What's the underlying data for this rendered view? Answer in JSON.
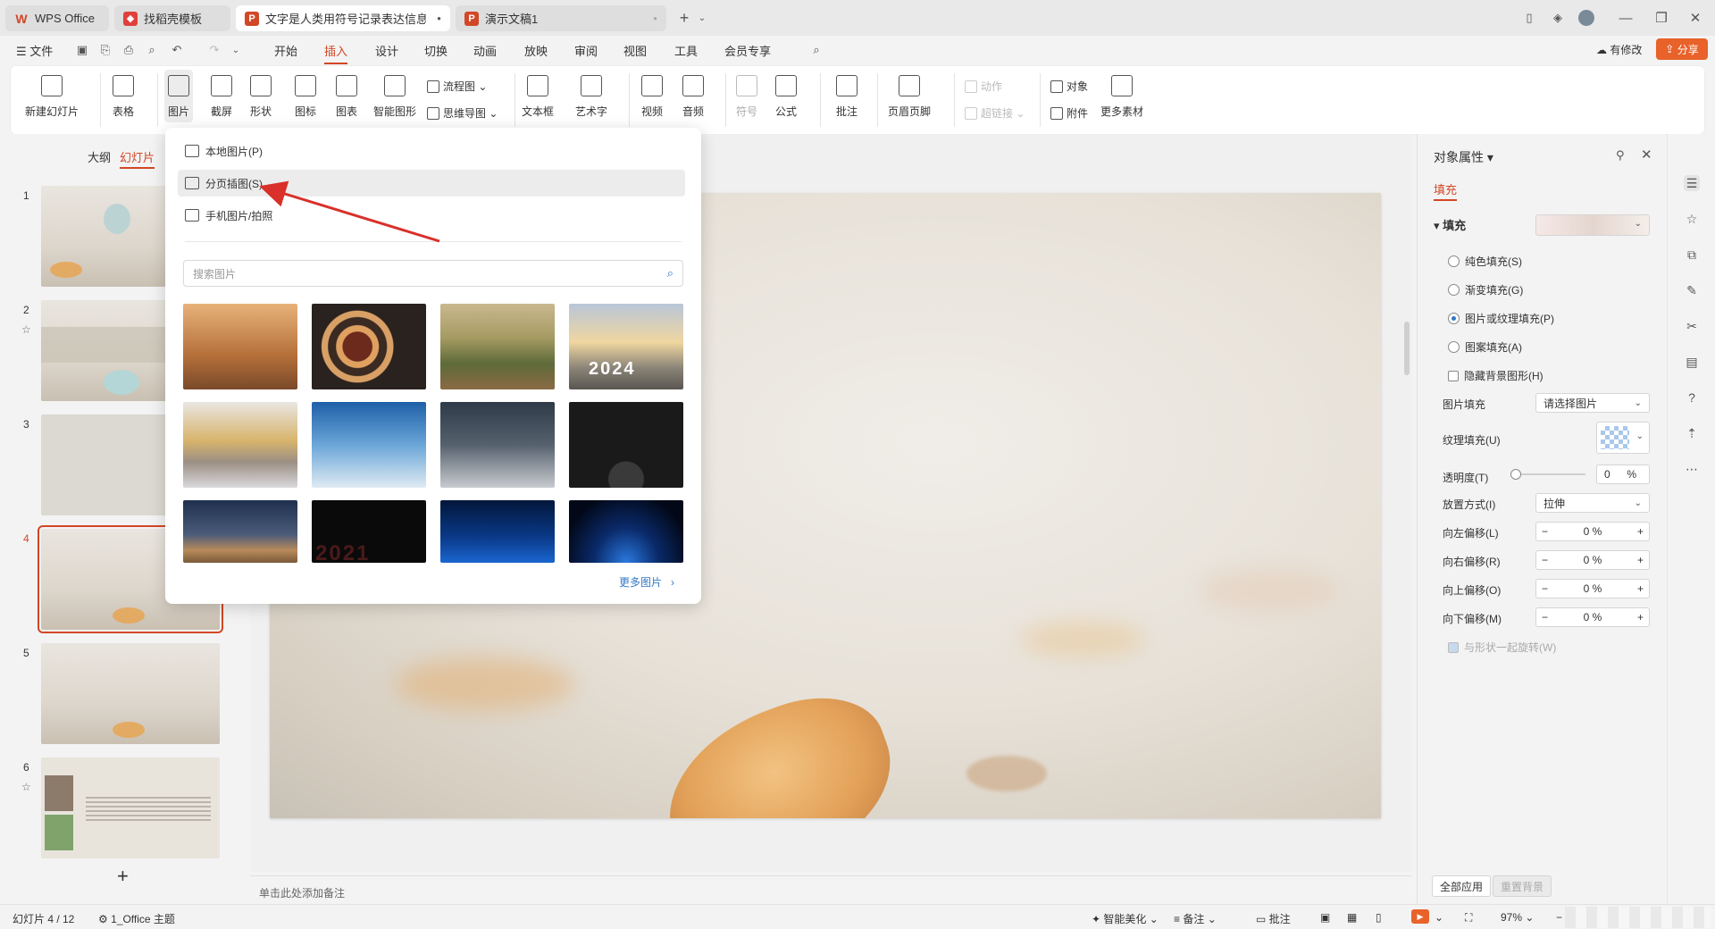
{
  "tabs": [
    {
      "label": "WPS Office",
      "icon": "wps-logo-icon",
      "color": "#d24726"
    },
    {
      "label": "找稻壳模板",
      "icon": "docer-icon",
      "color": "#e0403c"
    },
    {
      "label": "文字是人类用符号记录表达信息以",
      "icon": "ppt-icon",
      "color": "#d24726"
    },
    {
      "label": "演示文稿1",
      "icon": "ppt-icon",
      "color": "#d24726"
    }
  ],
  "menu": {
    "file": "文件",
    "items": [
      "开始",
      "插入",
      "设计",
      "切换",
      "动画",
      "放映",
      "审阅",
      "视图",
      "工具",
      "会员专享"
    ],
    "active": "插入",
    "modified": "有修改",
    "share": "分享"
  },
  "ribbon": {
    "new_slide": "新建幻灯片",
    "table": "表格",
    "picture": "图片",
    "screenshot": "截屏",
    "shape": "形状",
    "icon": "图标",
    "chart": "图表",
    "smart_graphic": "智能图形",
    "flowchart": "流程图",
    "mindmap": "思维导图",
    "textbox": "文本框",
    "wordart": "艺术字",
    "video": "视频",
    "audio": "音频",
    "symbol": "符号",
    "formula": "公式",
    "comment": "批注",
    "header_footer": "页眉页脚",
    "action": "动作",
    "hyperlink": "超链接",
    "object": "对象",
    "attachment": "附件",
    "more_material": "更多素材"
  },
  "left_panel": {
    "tab_outline": "大纲",
    "tab_slides": "幻灯片",
    "slides": [
      "1",
      "2",
      "3",
      "4",
      "5",
      "6"
    ],
    "selected": "4"
  },
  "dropdown": {
    "items": [
      "本地图片(P)",
      "分页插图(S)",
      "手机图片/拍照"
    ],
    "search_placeholder": "搜索图片",
    "more": "更多图片",
    "thumb_text_2024": "2024",
    "thumb_text_2021": "2021"
  },
  "notes_placeholder": "单击此处添加备注",
  "right_panel": {
    "title": "对象属性",
    "tab_fill": "填充",
    "section_fill": "填充",
    "options": [
      "纯色填充(S)",
      "渐变填充(G)",
      "图片或纹理填充(P)",
      "图案填充(A)"
    ],
    "selected_option": "图片或纹理填充(P)",
    "hide_bg": "隐藏背景图形(H)",
    "picture_fill_label": "图片填充",
    "picture_fill_value": "请选择图片",
    "texture_fill_label": "纹理填充(U)",
    "transparency_label": "透明度(T)",
    "transparency_value": "0",
    "transparency_unit": "%",
    "placement_label": "放置方式(I)",
    "placement_value": "拉伸",
    "offset_left_label": "向左偏移(L)",
    "offset_right_label": "向右偏移(R)",
    "offset_up_label": "向上偏移(O)",
    "offset_down_label": "向下偏移(M)",
    "offset_value": "0 %",
    "rotate_with_shape": "与形状一起旋转(W)",
    "apply_all": "全部应用",
    "reset_bg": "重置背景"
  },
  "statusbar": {
    "slide_info": "幻灯片 4 / 12",
    "theme": "1_Office 主题",
    "beautify": "智能美化",
    "notes": "备注",
    "comments": "批注",
    "zoom": "97%"
  },
  "colors": {
    "accent": "#d24726",
    "share": "#e8622a",
    "link": "#3478c6"
  }
}
